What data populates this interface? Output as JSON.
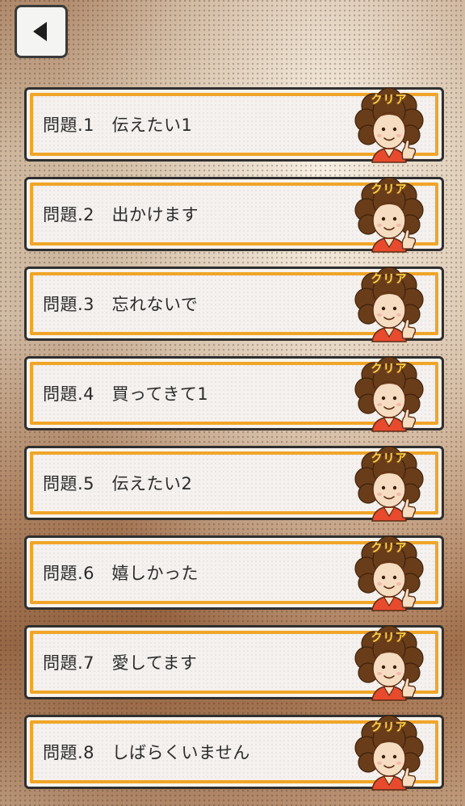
{
  "back_button": {
    "icon": "back-arrow-icon"
  },
  "colors": {
    "frame_border": "#2f2f2f",
    "accent_orange": "#f0a528",
    "panel": "#f4f1ee"
  },
  "problems": [
    {
      "label": "問題.1　伝えたい1",
      "badge": "クリア"
    },
    {
      "label": "問題.2　出かけます",
      "badge": "クリア"
    },
    {
      "label": "問題.3　忘れないで",
      "badge": "クリア"
    },
    {
      "label": "問題.4　買ってきて1",
      "badge": "クリア"
    },
    {
      "label": "問題.5　伝えたい2",
      "badge": "クリア"
    },
    {
      "label": "問題.6　嬉しかった",
      "badge": "クリア"
    },
    {
      "label": "問題.7　愛してます",
      "badge": "クリア"
    },
    {
      "label": "問題.8　しばらくいません",
      "badge": "クリア"
    }
  ]
}
